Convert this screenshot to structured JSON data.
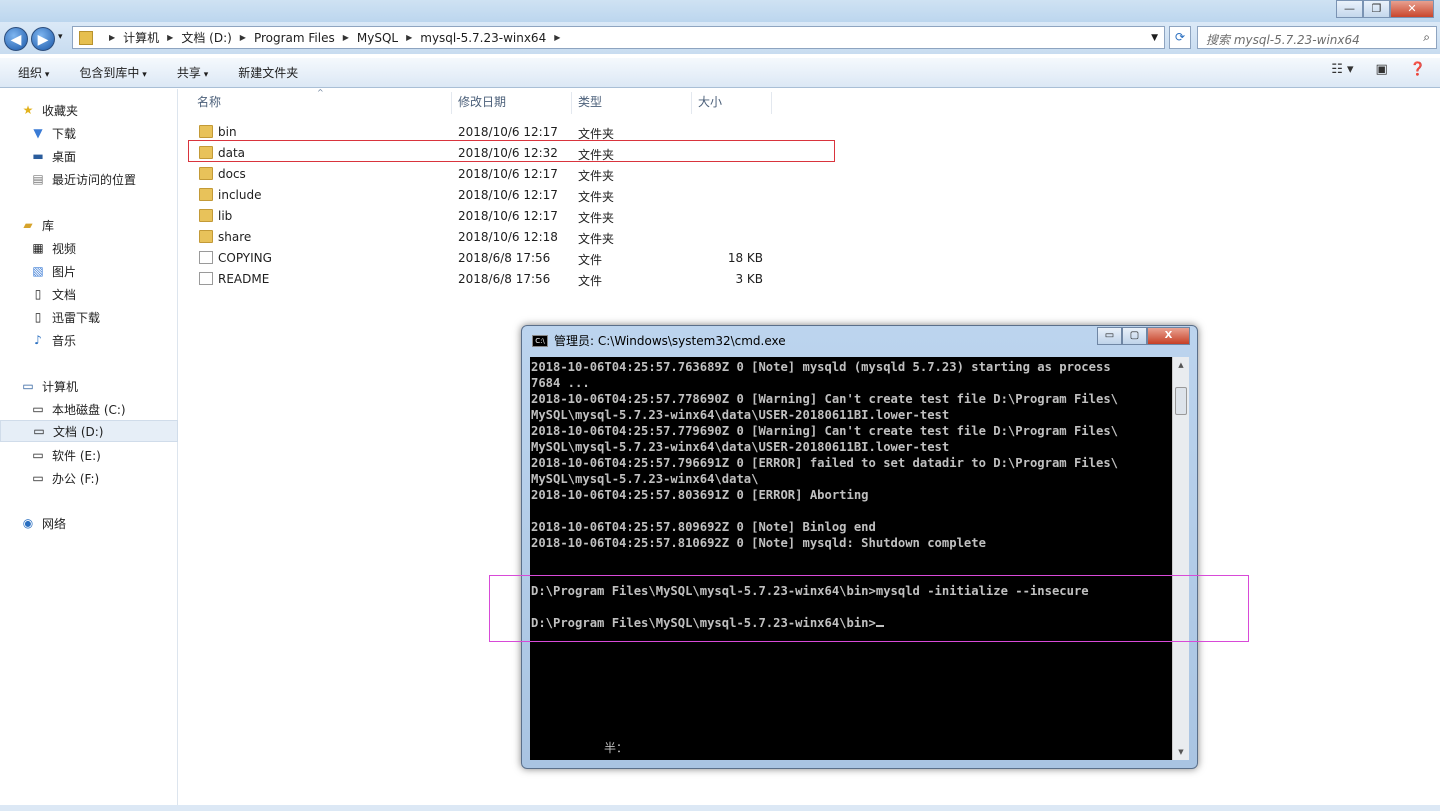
{
  "explorer": {
    "breadcrumb": [
      "计算机",
      "文档 (D:)",
      "Program Files",
      "MySQL",
      "mysql-5.7.23-winx64"
    ],
    "search_placeholder": "搜索 mysql-5.7.23-winx64",
    "toolbar": {
      "organize": "组织",
      "include_library": "包含到库中",
      "share": "共享",
      "new_folder": "新建文件夹"
    },
    "sidebar": {
      "favorites": {
        "label": "收藏夹",
        "items": [
          "下载",
          "桌面",
          "最近访问的位置"
        ]
      },
      "libraries": {
        "label": "库",
        "items": [
          "视频",
          "图片",
          "文档",
          "迅雷下载",
          "音乐"
        ]
      },
      "computer": {
        "label": "计算机",
        "items": [
          "本地磁盘 (C:)",
          "文档 (D:)",
          "软件 (E:)",
          "办公 (F:)"
        ]
      },
      "network": {
        "label": "网络"
      }
    },
    "columns": {
      "name": "名称",
      "modified": "修改日期",
      "type": "类型",
      "size": "大小"
    },
    "files": [
      {
        "name": "bin",
        "modified": "2018/10/6 12:17",
        "type": "文件夹",
        "size": "",
        "kind": "folder"
      },
      {
        "name": "data",
        "modified": "2018/10/6 12:32",
        "type": "文件夹",
        "size": "",
        "kind": "folder"
      },
      {
        "name": "docs",
        "modified": "2018/10/6 12:17",
        "type": "文件夹",
        "size": "",
        "kind": "folder"
      },
      {
        "name": "include",
        "modified": "2018/10/6 12:17",
        "type": "文件夹",
        "size": "",
        "kind": "folder"
      },
      {
        "name": "lib",
        "modified": "2018/10/6 12:17",
        "type": "文件夹",
        "size": "",
        "kind": "folder"
      },
      {
        "name": "share",
        "modified": "2018/10/6 12:18",
        "type": "文件夹",
        "size": "",
        "kind": "folder"
      },
      {
        "name": "COPYING",
        "modified": "2018/6/8 17:56",
        "type": "文件",
        "size": "18 KB",
        "kind": "file"
      },
      {
        "name": "README",
        "modified": "2018/6/8 17:56",
        "type": "文件",
        "size": "3 KB",
        "kind": "file"
      }
    ]
  },
  "cmd": {
    "title": "管理员: C:\\Windows\\system32\\cmd.exe",
    "lines": [
      "2018-10-06T04:25:57.763689Z 0 [Note] mysqld (mysqld 5.7.23) starting as process",
      "7684 ...",
      "2018-10-06T04:25:57.778690Z 0 [Warning] Can't create test file D:\\Program Files\\",
      "MySQL\\mysql-5.7.23-winx64\\data\\USER-20180611BI.lower-test",
      "2018-10-06T04:25:57.779690Z 0 [Warning] Can't create test file D:\\Program Files\\",
      "MySQL\\mysql-5.7.23-winx64\\data\\USER-20180611BI.lower-test",
      "2018-10-06T04:25:57.796691Z 0 [ERROR] failed to set datadir to D:\\Program Files\\",
      "MySQL\\mysql-5.7.23-winx64\\data\\",
      "2018-10-06T04:25:57.803691Z 0 [ERROR] Aborting",
      "",
      "2018-10-06T04:25:57.809692Z 0 [Note] Binlog end",
      "2018-10-06T04:25:57.810692Z 0 [Note] mysqld: Shutdown complete",
      "",
      "",
      "D:\\Program Files\\MySQL\\mysql-5.7.23-winx64\\bin>mysqld -initialize --insecure",
      ""
    ],
    "prompt": "D:\\Program Files\\MySQL\\mysql-5.7.23-winx64\\bin>",
    "ime_status": "半："
  }
}
